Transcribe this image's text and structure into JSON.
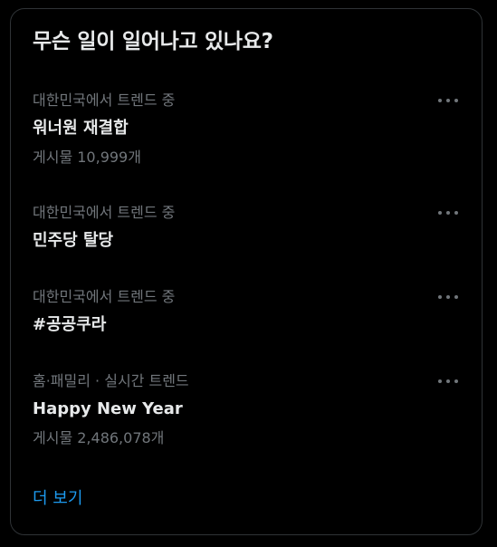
{
  "panel": {
    "title": "무슨 일이 일어나고 있나요?",
    "show_more_label": "더 보기",
    "accent_color": "#1d9bf0",
    "more_icon": "ellipsis-icon",
    "trends": [
      {
        "context": "대한민국에서 트렌드 중",
        "name": "워너원 재결합",
        "count": "게시물 10,999개"
      },
      {
        "context": "대한민국에서 트렌드 중",
        "name": "민주당 탈당",
        "count": ""
      },
      {
        "context": "대한민국에서 트렌드 중",
        "name": "#공공쿠라",
        "count": ""
      },
      {
        "context": "홈·패밀리 · 실시간 트렌드",
        "name": "Happy New Year",
        "count": "게시물 2,486,078개"
      }
    ]
  }
}
